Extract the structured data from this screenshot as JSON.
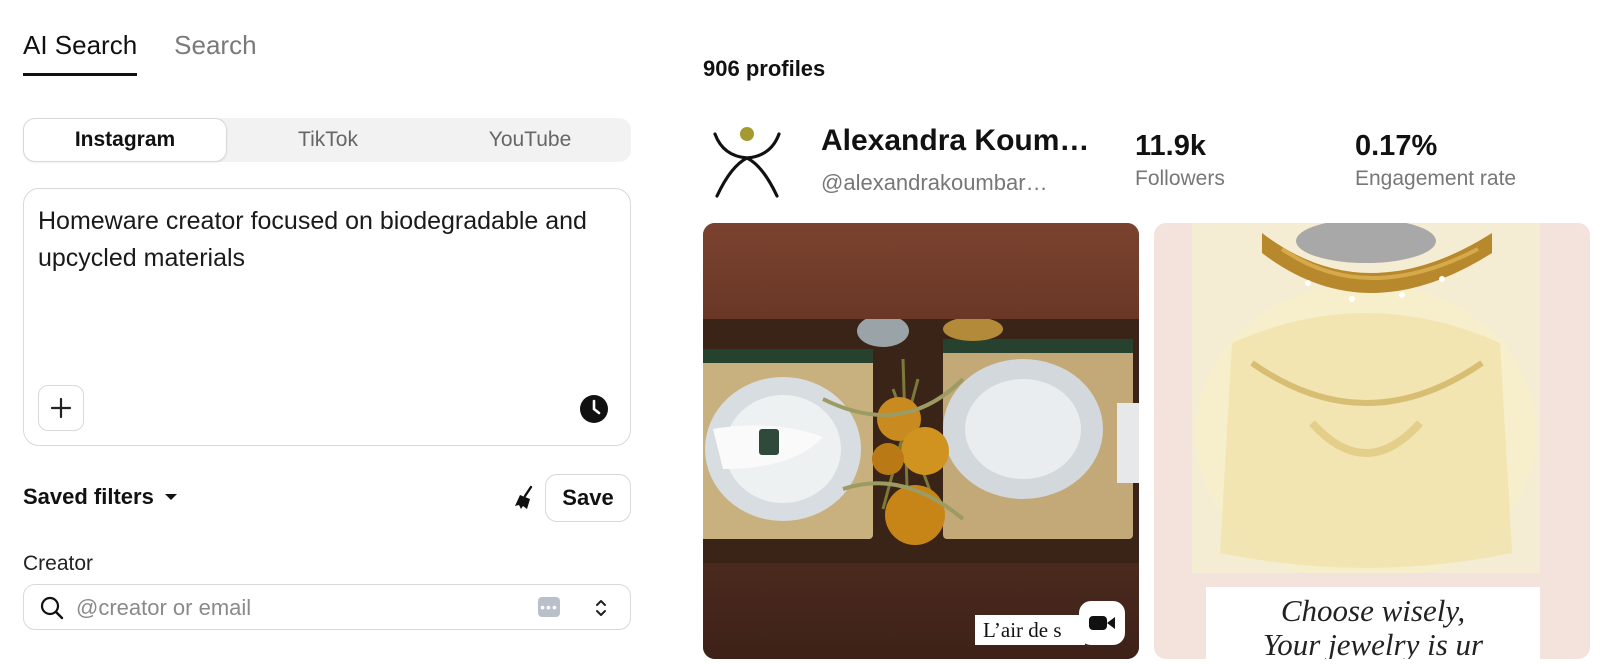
{
  "mode_tabs": [
    {
      "label": "AI Search",
      "active": true
    },
    {
      "label": "Search",
      "active": false
    }
  ],
  "platforms": [
    {
      "label": "Instagram",
      "active": true
    },
    {
      "label": "TikTok",
      "active": false
    },
    {
      "label": "YouTube",
      "active": false
    }
  ],
  "prompt": {
    "value": "Homeware creator focused on biodegradable and upcycled materials",
    "add_icon": "plus-icon",
    "history_icon": "clock-icon"
  },
  "saved_filters": {
    "label": "Saved filters",
    "clear_icon": "broom-icon",
    "save_label": "Save"
  },
  "creator_filter": {
    "label": "Creator",
    "placeholder": "@creator or email"
  },
  "results": {
    "count_text": "906 profiles",
    "profiles": [
      {
        "name": "Alexandra Koumbaroudis",
        "handle": "@alexandrakoumbaroudis",
        "followers": "11.9k",
        "followers_label": "Followers",
        "engagement": "0.17%",
        "engagement_label": "Engagement rate",
        "posts": [
          {
            "kind": "video",
            "caption": "L’air de s"
          },
          {
            "kind": "image",
            "caption_lines": [
              "Choose wisely,",
              "Your jewelry is ur"
            ]
          }
        ]
      }
    ]
  },
  "colors": {
    "accent": "#111111",
    "muted": "#777777",
    "border": "#d9d9d9",
    "avatar_dot": "#a59a2f"
  }
}
